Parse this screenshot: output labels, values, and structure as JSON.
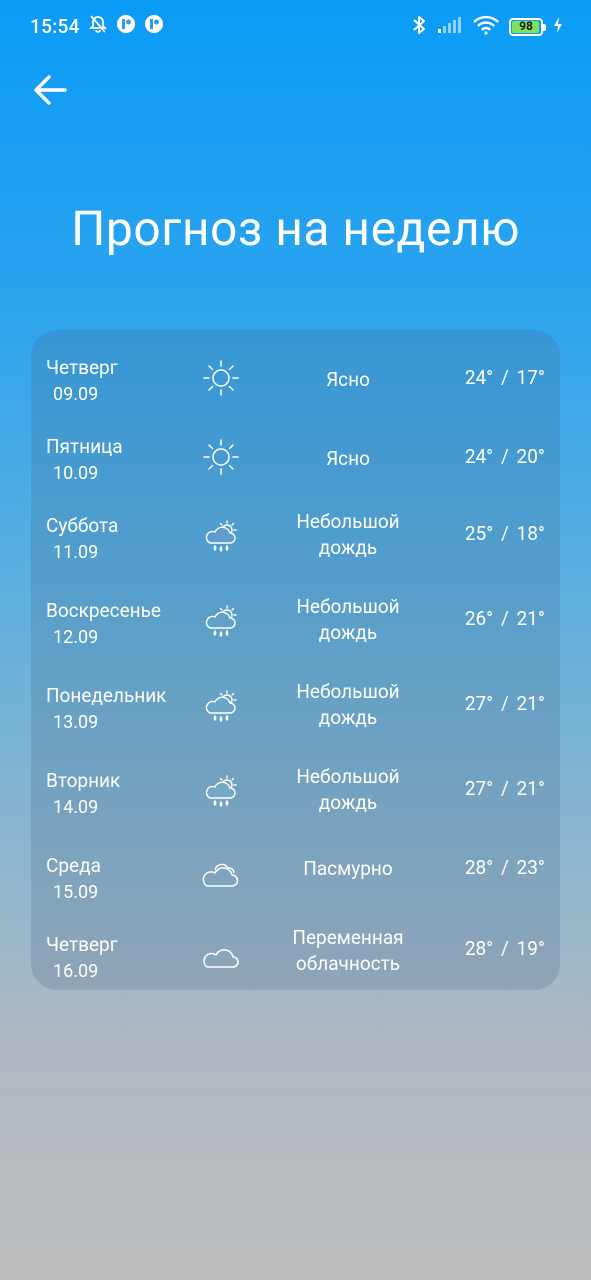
{
  "status_bar": {
    "time": "15:54",
    "battery": "98",
    "battery_level": 0.98,
    "icons": [
      "bell-off-icon",
      "app-notification-icon",
      "app-notification-icon",
      "bluetooth-icon",
      "signal-icon",
      "wifi-icon",
      "battery-icon",
      "charging-icon"
    ]
  },
  "header": {
    "back_icon": "arrow-left-icon",
    "title": "Прогноз на неделю"
  },
  "forecast": [
    {
      "day": "Четверг",
      "date": "09.09",
      "icon": "sunny-icon",
      "condition_lines": [
        "Ясно"
      ],
      "temps": "24° / 17°"
    },
    {
      "day": "Пятница",
      "date": "10.09",
      "icon": "sunny-icon",
      "condition_lines": [
        "Ясно"
      ],
      "temps": "24° / 20°"
    },
    {
      "day": "Суббота",
      "date": "11.09",
      "icon": "light-rain-icon",
      "condition_lines": [
        "Небольшой",
        "дождь"
      ],
      "temps": "25° / 18°"
    },
    {
      "day": "Воскресенье",
      "date": "12.09",
      "icon": "light-rain-icon",
      "condition_lines": [
        "Небольшой",
        "дождь"
      ],
      "temps": "26° / 21°"
    },
    {
      "day": "Понедельник",
      "date": "13.09",
      "icon": "light-rain-icon",
      "condition_lines": [
        "Небольшой",
        "дождь"
      ],
      "temps": "27° / 21°"
    },
    {
      "day": "Вторник",
      "date": "14.09",
      "icon": "light-rain-icon",
      "condition_lines": [
        "Небольшой",
        "дождь"
      ],
      "temps": "27° / 21°"
    },
    {
      "day": "Среда",
      "date": "15.09",
      "icon": "overcast-icon",
      "condition_lines": [
        "Пасмурно"
      ],
      "temps": "28° / 23°"
    },
    {
      "day": "Четверг",
      "date": "16.09",
      "icon": "partly-cloudy-icon",
      "condition_lines": [
        "Переменная",
        "облачность"
      ],
      "temps": "28° / 19°"
    }
  ]
}
